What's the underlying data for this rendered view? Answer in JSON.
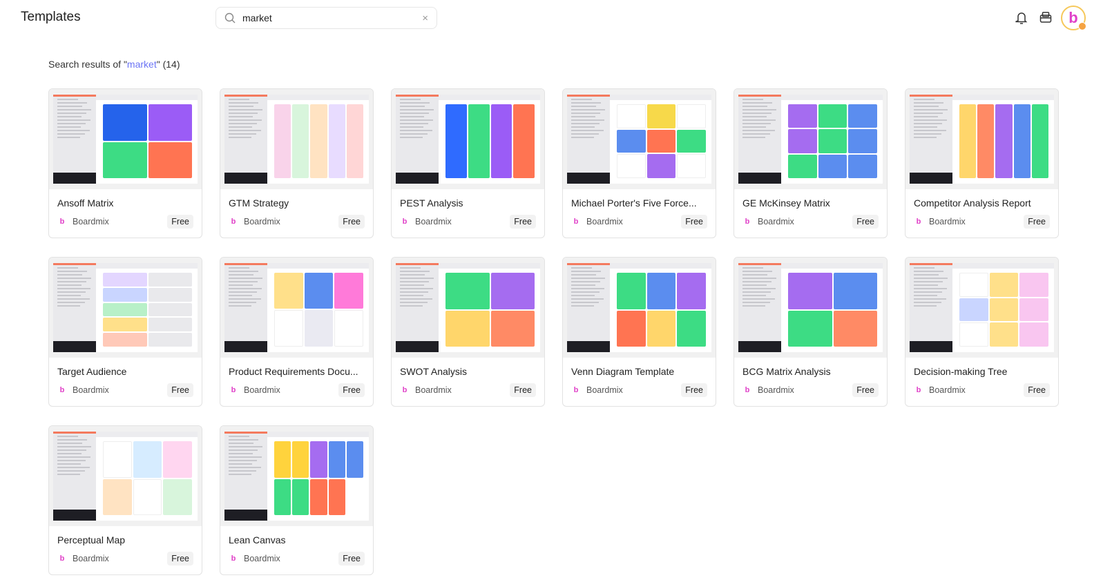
{
  "header": {
    "title": "Templates",
    "search_value": "market",
    "clear_icon": "×"
  },
  "results": {
    "prefix": "Search results of \"",
    "query": "market",
    "suffix": "\" (14)"
  },
  "accent": "#6b74f5",
  "cards": [
    {
      "title": "Ansoff Matrix",
      "author": "Boardmix",
      "badge": "Free",
      "colors": [
        "#2563eb",
        "#9b5cf6",
        "#3ddc84",
        "#ff7452"
      ],
      "cols": 2
    },
    {
      "title": "GTM Strategy",
      "author": "Boardmix",
      "badge": "Free",
      "colors": [
        "#f9d3ea",
        "#d8f5dc",
        "#ffe3c2",
        "#e8dcff",
        "#ffd6d6"
      ],
      "cols": 5
    },
    {
      "title": "PEST Analysis",
      "author": "Boardmix",
      "badge": "Free",
      "colors": [
        "#2f6bff",
        "#3ddc84",
        "#9b5cf6",
        "#ff7452"
      ],
      "cols": 4
    },
    {
      "title": "Michael Porter's Five Force...",
      "author": "Boardmix",
      "badge": "Free",
      "colors": [
        "#ffffff",
        "#f7d94a",
        "#ffffff",
        "#5b8def",
        "#ff7452",
        "#3ddc84",
        "#ffffff",
        "#a56cf0",
        "#ffffff"
      ],
      "cols": 3
    },
    {
      "title": "GE McKinsey Matrix",
      "author": "Boardmix",
      "badge": "Free",
      "colors": [
        "#a56cf0",
        "#3ddc84",
        "#5b8def",
        "#a56cf0",
        "#3ddc84",
        "#5b8def",
        "#3ddc84",
        "#5b8def",
        "#5b8def"
      ],
      "cols": 3
    },
    {
      "title": "Competitor Analysis Report",
      "author": "Boardmix",
      "badge": "Free",
      "colors": [
        "#ffd66b",
        "#ff8a65",
        "#a56cf0",
        "#5b8def",
        "#3ddc84"
      ],
      "cols": 5
    },
    {
      "title": "Target Audience",
      "author": "Boardmix",
      "badge": "Free",
      "colors": [
        "#e3d6ff",
        "#e9e9ec",
        "#c9d5ff",
        "#e9e9ec",
        "#b8f0c8",
        "#e9e9ec",
        "#ffe08a",
        "#e9e9ec",
        "#ffc9b8",
        "#e9e9ec"
      ],
      "cols": 2
    },
    {
      "title": "Product Requirements Docu...",
      "author": "Boardmix",
      "badge": "Free",
      "colors": [
        "#ffe08a",
        "#5b8def",
        "#ff7ad9",
        "#ffffff",
        "#eaeaf2",
        "#ffffff"
      ],
      "cols": 3
    },
    {
      "title": "SWOT Analysis",
      "author": "Boardmix",
      "badge": "Free",
      "colors": [
        "#3ddc84",
        "#a56cf0",
        "#ffd66b",
        "#ff8a65"
      ],
      "cols": 2
    },
    {
      "title": "Venn Diagram Template",
      "author": "Boardmix",
      "badge": "Free",
      "colors": [
        "#3ddc84",
        "#5b8def",
        "#a56cf0",
        "#ff7452",
        "#ffd66b",
        "#3ddc84"
      ],
      "cols": 3
    },
    {
      "title": "BCG Matrix Analysis",
      "author": "Boardmix",
      "badge": "Free",
      "colors": [
        "#a56cf0",
        "#5b8def",
        "#3ddc84",
        "#ff8a65"
      ],
      "cols": 2
    },
    {
      "title": "Decision-making Tree",
      "author": "Boardmix",
      "badge": "Free",
      "colors": [
        "#ffffff",
        "#ffe08a",
        "#f9c6f0",
        "#c9d5ff",
        "#ffe08a",
        "#f9c6f0",
        "#ffffff",
        "#ffe08a",
        "#f9c6f0"
      ],
      "cols": 3
    },
    {
      "title": "Perceptual Map",
      "author": "Boardmix",
      "badge": "Free",
      "colors": [
        "#ffffff",
        "#d6ecff",
        "#ffd6f0",
        "#ffe3c2",
        "#ffffff",
        "#d8f5dc"
      ],
      "cols": 3
    },
    {
      "title": "Lean Canvas",
      "author": "Boardmix",
      "badge": "Free",
      "colors": [
        "#ffd33d",
        "#ffd33d",
        "#a56cf0",
        "#5b8def",
        "#5b8def",
        "#3ddc84",
        "#3ddc84",
        "#ff7452",
        "#ff7452"
      ],
      "cols": 5
    }
  ]
}
